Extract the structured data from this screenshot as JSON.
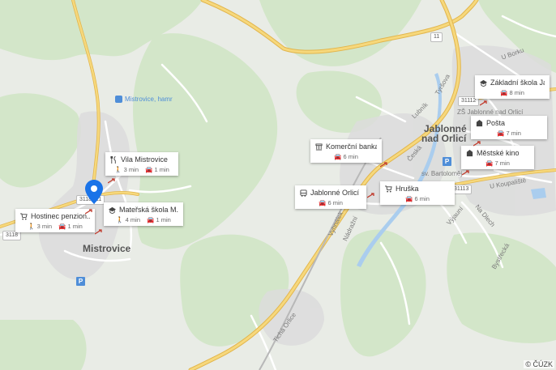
{
  "map": {
    "colors": {
      "land": "#e9ece6",
      "forest": "#d2e6c8",
      "urban": "#dedede",
      "road_major": "#f5d67a",
      "road_major_edge": "#e3b64a",
      "road_minor": "#ffffff",
      "water": "#a8cdf0",
      "pin": "#1a73e8",
      "transit": "#4f8ed8",
      "walk_arrow": "#c0392b"
    },
    "towns": [
      {
        "id": "mistrovice",
        "name": "Mistrovice"
      },
      {
        "id": "jablonne-1",
        "name": "Jablonné"
      },
      {
        "id": "jablonne-2",
        "name": "nad Orlicí"
      }
    ],
    "streets": {
      "lubnik": "Lubník",
      "tyrsova": "Tyršova",
      "ceska": "Česká",
      "vyhnalek": "Vyhnálek",
      "nadrazni": "Nádražní",
      "na_drahach": "Na Dlech",
      "ryzoviste": "Výjauní",
      "bystrecka": "Bystřecká",
      "u_koupaliste": "U Koupaliště",
      "u_borku": "U Borku",
      "sv_bartolomej": "sv. Bartoloměj",
      "zs": "ZŠ Jablonné nad Orlicí",
      "tichy_orlice": "Tichá Orlice"
    },
    "stop_labels": {
      "mistrovice_hamr": "Mistrovice, hamr"
    },
    "road_numbers": {
      "r11a": "11",
      "r11b": "11",
      "r31112": "31112",
      "r31113": "31113",
      "r3118a": "3118",
      "r3118b": "3118"
    },
    "parking_symbol": "P",
    "copyright": "© ČÚZK"
  },
  "pois": [
    {
      "id": "vila-mistrovice",
      "icon": "restaurant-icon",
      "title": "Vila Mistrovice",
      "walk": "3 min",
      "drive": "1 min"
    },
    {
      "id": "hostinec-penzion",
      "icon": "cart-icon",
      "title": "Hostinec penzion...",
      "walk": "3 min",
      "drive": "1 min"
    },
    {
      "id": "materska-skola",
      "icon": "school-icon",
      "title": "Mateřská škola M...",
      "walk": "4 min",
      "drive": "1 min"
    },
    {
      "id": "komercni-banka",
      "icon": "bank-icon",
      "title": "Komerční banka",
      "walk": "",
      "drive": "6 min"
    },
    {
      "id": "jablonne-orlici",
      "icon": "bus-icon",
      "title": "Jablonné Orlicí",
      "walk": "",
      "drive": "6 min"
    },
    {
      "id": "hruska",
      "icon": "cart-icon",
      "title": "Hruška",
      "walk": "",
      "drive": "6 min"
    },
    {
      "id": "zakladni-skola",
      "icon": "school-icon",
      "title": "Základní škola Ja...",
      "walk": "",
      "drive": "8 min"
    },
    {
      "id": "posta",
      "icon": "post-icon",
      "title": "Pošta",
      "walk": "",
      "drive": "7 min"
    },
    {
      "id": "mestske-kino",
      "icon": "cinema-icon",
      "title": "Městské kino",
      "walk": "",
      "drive": "7 min"
    }
  ]
}
